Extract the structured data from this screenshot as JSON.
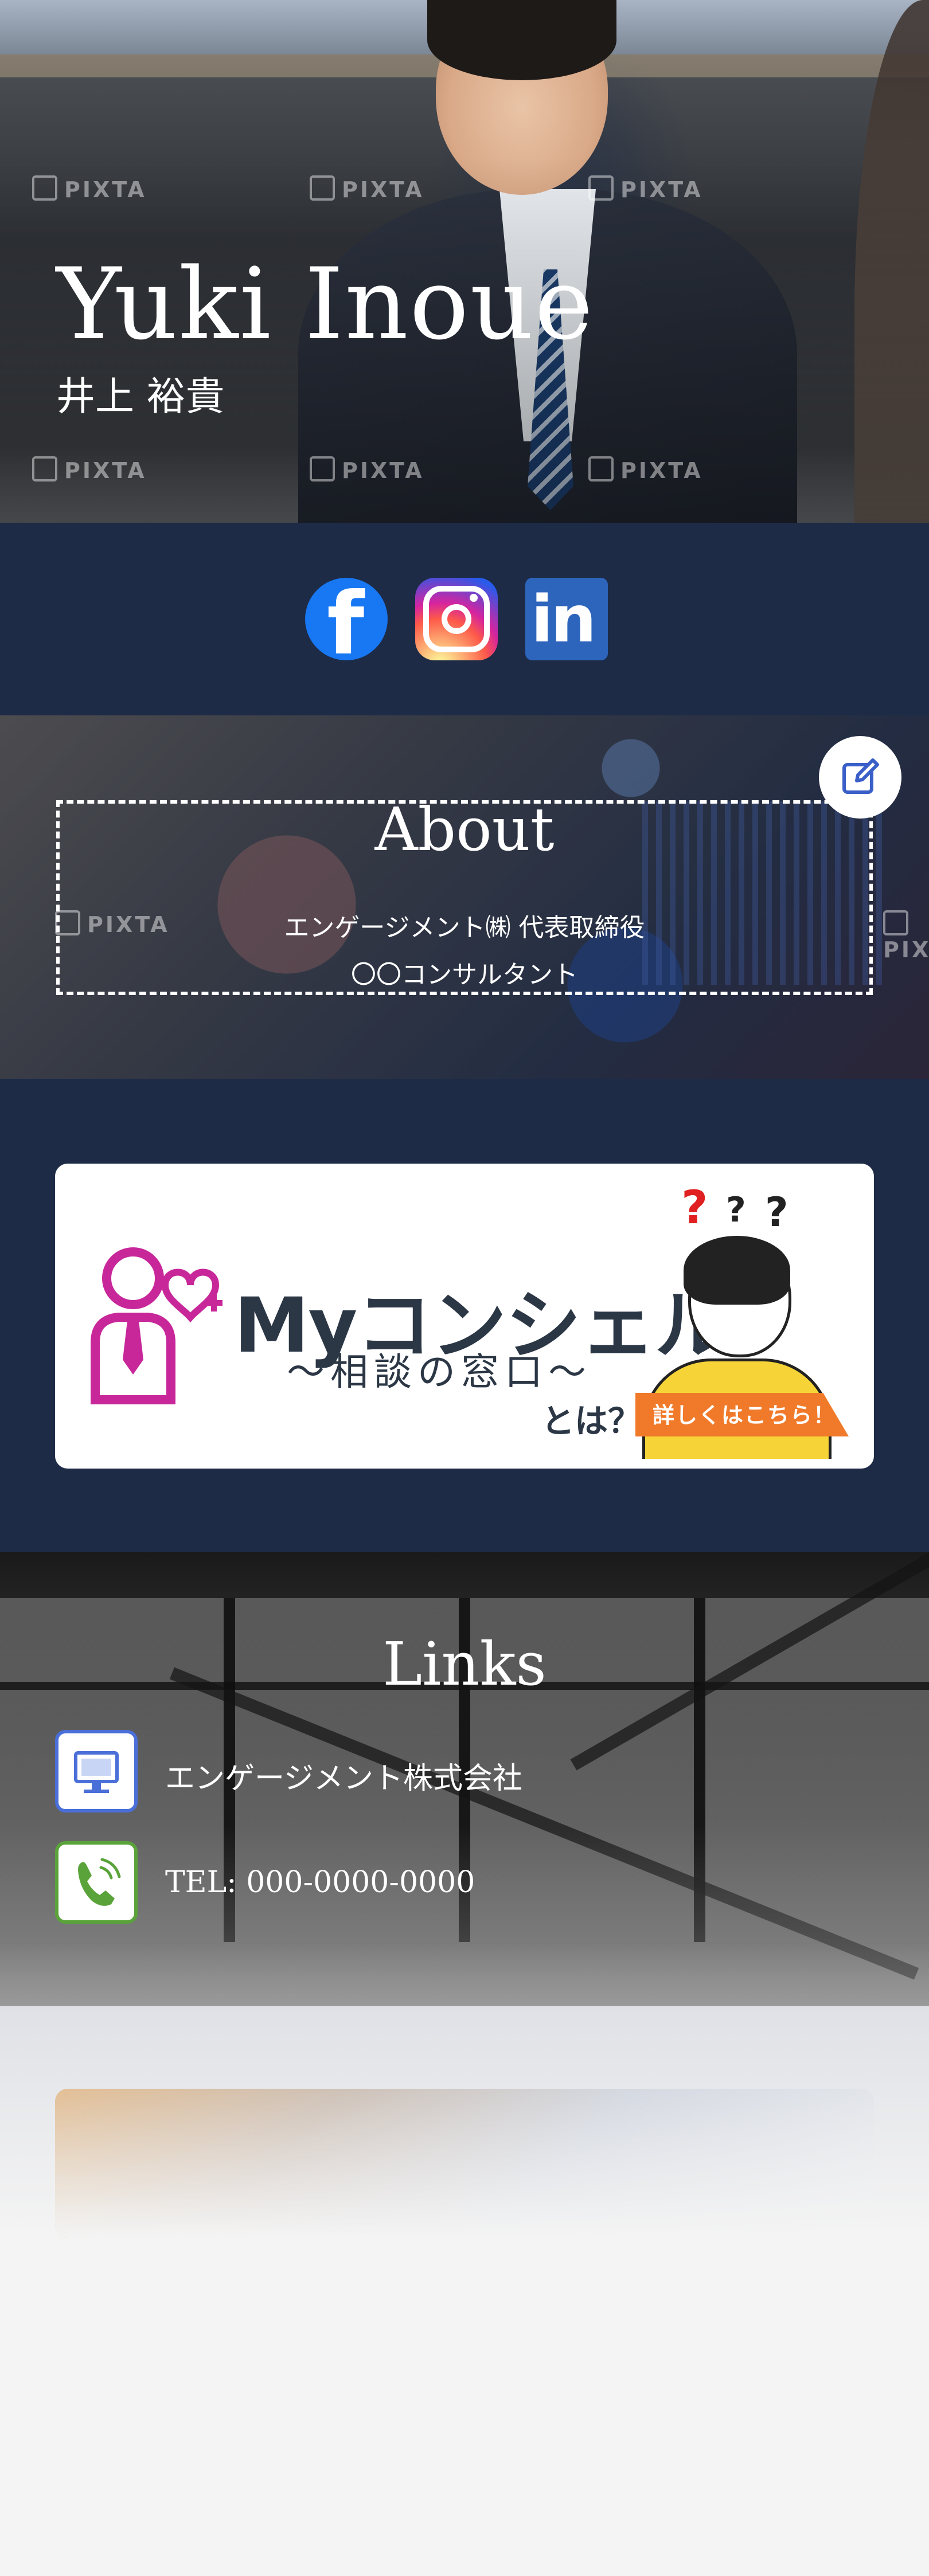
{
  "profile": {
    "name_en": "Yuki Inoue",
    "name_jp": "井上 裕貴"
  },
  "hero": {
    "watermark": "PIXTA"
  },
  "social": {
    "items": [
      {
        "name": "facebook",
        "icon": "facebook-icon",
        "color": "#1877f2"
      },
      {
        "name": "instagram",
        "icon": "instagram-icon",
        "color": "#d6249f"
      },
      {
        "name": "linkedin",
        "icon": "linkedin-icon",
        "color": "#2d64bc"
      }
    ],
    "fb_glyph": "f",
    "li_glyph": "in"
  },
  "about": {
    "title": "About",
    "line1": "エンゲージメント㈱ 代表取締役",
    "line2": "〇〇コンサルタント",
    "edit_icon": "edit-icon"
  },
  "banner": {
    "title": "Myコンシェル",
    "subtitle": "〜相談の窓口〜",
    "toha": "とは？",
    "cta": "詳しくはこちら！",
    "q1": "?",
    "q2": "?",
    "q3": "?",
    "accent": "#c8279a",
    "cta_color": "#f07a2a"
  },
  "links": {
    "title": "Links",
    "items": [
      {
        "icon": "desktop-icon",
        "label": "エンゲージメント株式会社",
        "border": "#4a6fd8"
      },
      {
        "icon": "phone-icon",
        "label": "TEL: 000-0000-0000",
        "border": "#5aa33a"
      }
    ]
  },
  "colors": {
    "navy": "#1d2b47",
    "page_bg": "#f4f4f4"
  }
}
